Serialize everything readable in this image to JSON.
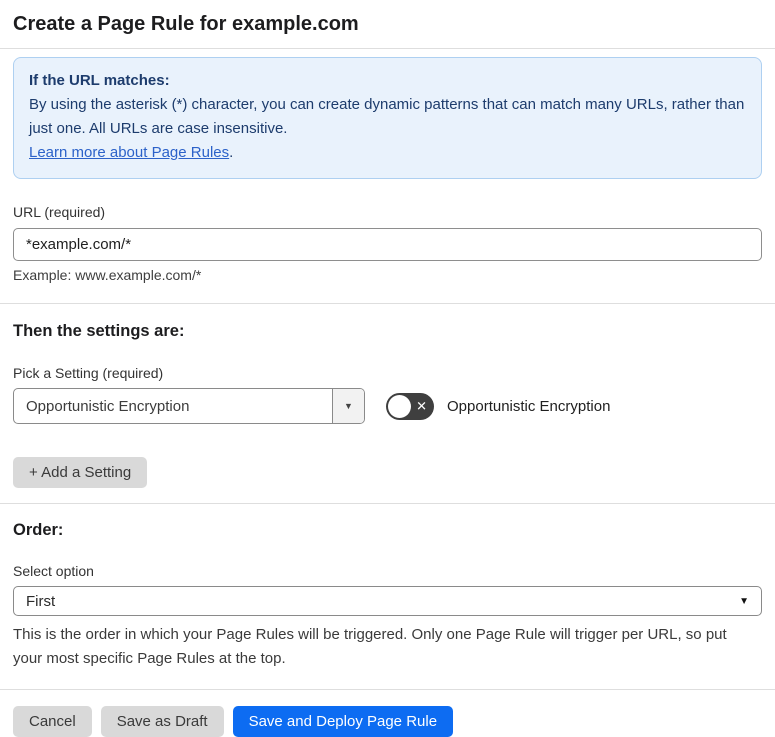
{
  "page": {
    "title": "Create a Page Rule for example.com"
  },
  "info_box": {
    "heading": "If the URL matches:",
    "body": "By using the asterisk (*) character, you can create dynamic patterns that can match many URLs, rather than just one. All URLs are case insensitive.",
    "link_label": "Learn more about Page Rules",
    "link_suffix": "."
  },
  "url_field": {
    "label": "URL (required)",
    "value": "*example.com/*",
    "example": "Example: www.example.com/*"
  },
  "settings_section": {
    "heading": "Then the settings are:",
    "pick_setting_label": "Pick a Setting (required)",
    "selected_setting": "Opportunistic Encryption",
    "toggle_state": "off",
    "toggle_label": "Opportunistic Encryption",
    "add_setting_button": "+ Add a Setting"
  },
  "order_section": {
    "heading": "Order:",
    "select_label": "Select option",
    "selected_option": "First",
    "description": "This is the order in which your Page Rules will be triggered. Only one Page Rule will trigger per URL, so put your most specific Page Rules at the top."
  },
  "footer": {
    "cancel_label": "Cancel",
    "save_draft_label": "Save as Draft",
    "save_deploy_label": "Save and Deploy Page Rule"
  },
  "icons": {
    "toggle_x": "✕",
    "select_caret": "▼"
  },
  "colors": {
    "primary_blue": "#0d6cf2",
    "info_bg": "#e9f2fc",
    "info_border": "#aed0f1",
    "info_text": "#1d3c6d",
    "link_blue": "#2c62c9",
    "toggle_off_bg": "#3f3f3f",
    "gray_button_bg": "#d9d9d9",
    "divider": "#dedede"
  }
}
